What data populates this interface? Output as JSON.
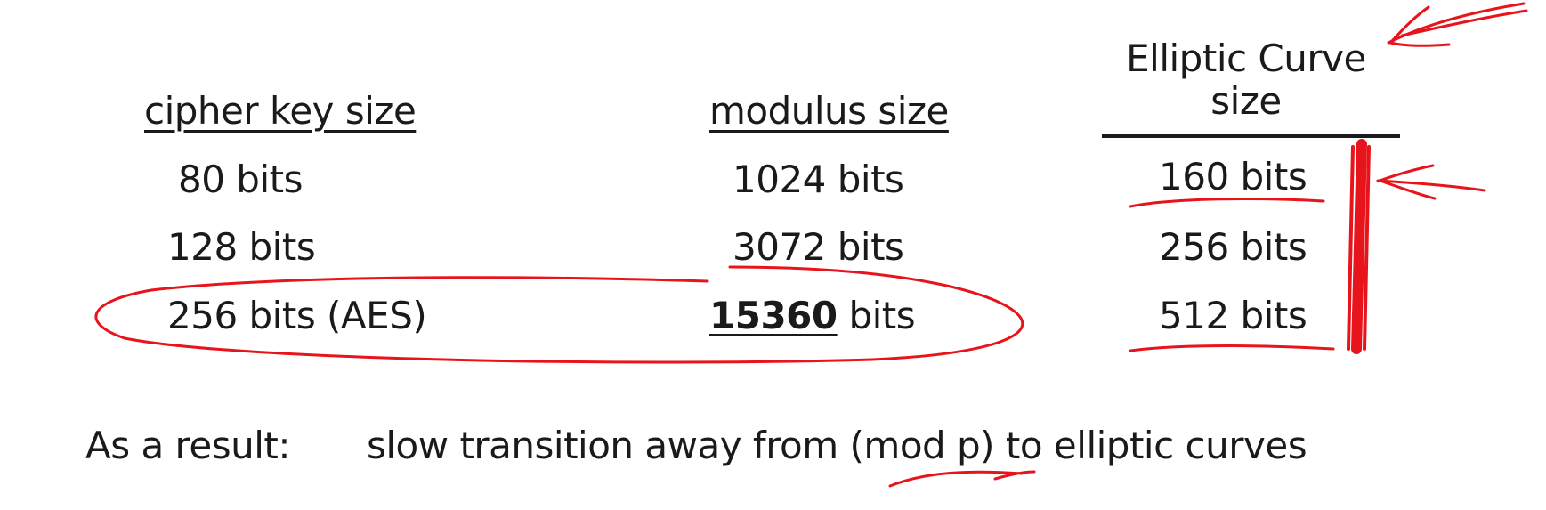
{
  "table": {
    "headers": {
      "cipher_key_size": "cipher key size",
      "modulus_size": "modulus size",
      "elliptic_curve_line1": "Elliptic Curve",
      "elliptic_curve_line2": "size"
    },
    "rows": [
      {
        "cipher": "80 bits",
        "modulus_num": "1024",
        "modulus_unit": " bits",
        "ec": "160 bits"
      },
      {
        "cipher": "128 bits",
        "modulus_num": "3072",
        "modulus_unit": " bits",
        "ec": "256 bits"
      },
      {
        "cipher": "256 bits (AES)",
        "modulus_num": "15360",
        "modulus_unit": " bits",
        "ec": "512 bits"
      }
    ]
  },
  "conclusion": {
    "label": "As a result:",
    "text": "slow transition away from (mod p) to elliptic curves"
  },
  "colors": {
    "text": "#1a1a1a",
    "annotation_ink": "#e8141b",
    "background": "#ffffff"
  }
}
